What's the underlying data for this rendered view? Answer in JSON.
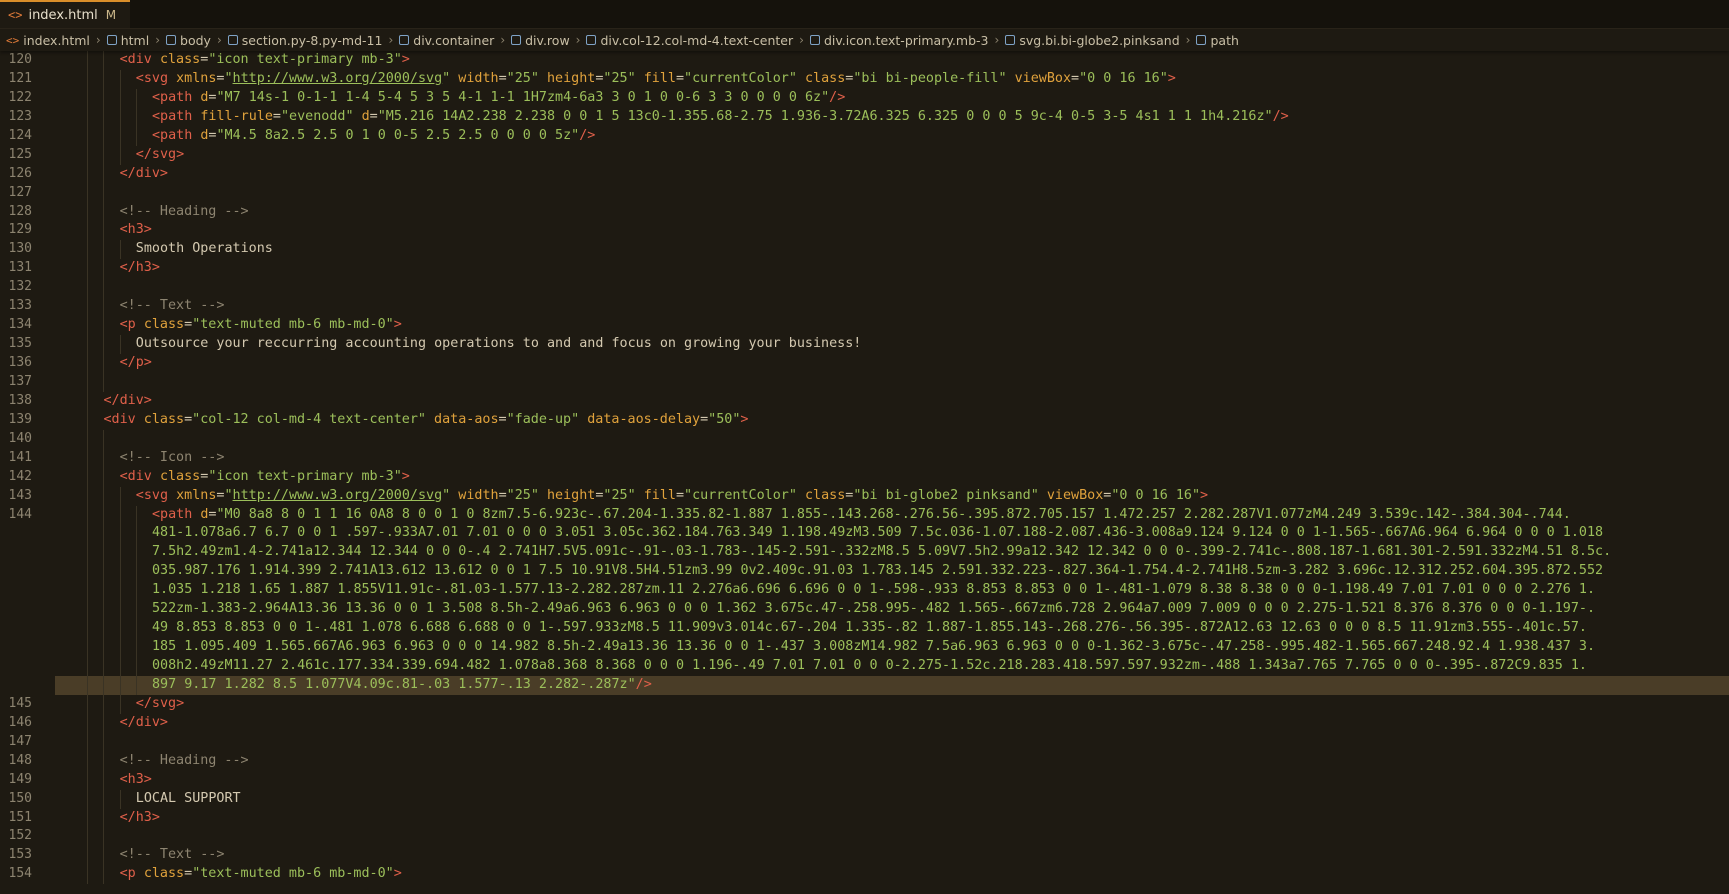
{
  "tab": {
    "filename": "index.html",
    "status": "M",
    "icon": "html-file-icon"
  },
  "breadcrumb": [
    {
      "label": "index.html",
      "icon": "html-file-icon"
    },
    {
      "label": "html",
      "icon": "element-icon"
    },
    {
      "label": "body",
      "icon": "element-icon"
    },
    {
      "label": "section.py-8.py-md-11",
      "icon": "element-icon"
    },
    {
      "label": "div.container",
      "icon": "element-icon"
    },
    {
      "label": "div.row",
      "icon": "element-icon"
    },
    {
      "label": "div.col-12.col-md-4.text-center",
      "icon": "element-icon"
    },
    {
      "label": "div.icon.text-primary.mb-3",
      "icon": "element-icon"
    },
    {
      "label": "svg.bi.bi-globe2.pinksand",
      "icon": "element-icon"
    },
    {
      "label": "path",
      "icon": "element-icon"
    }
  ],
  "lines": [
    {
      "n": "120",
      "indent": 8,
      "tokens": [
        [
          "tag",
          "<div "
        ],
        [
          "attr",
          "class"
        ],
        [
          "pun",
          "="
        ],
        [
          "str",
          "\"icon text-primary mb-3\""
        ],
        [
          "tag",
          ">"
        ]
      ]
    },
    {
      "n": "121",
      "indent": 10,
      "tokens": [
        [
          "tag",
          "<svg "
        ],
        [
          "attr",
          "xmlns"
        ],
        [
          "pun",
          "="
        ],
        [
          "str",
          "\""
        ],
        [
          "url",
          "http://www.w3.org/2000/svg"
        ],
        [
          "str",
          "\""
        ],
        [
          "pun",
          " "
        ],
        [
          "attr",
          "width"
        ],
        [
          "pun",
          "="
        ],
        [
          "str",
          "\"25\""
        ],
        [
          "pun",
          " "
        ],
        [
          "attr",
          "height"
        ],
        [
          "pun",
          "="
        ],
        [
          "str",
          "\"25\""
        ],
        [
          "pun",
          " "
        ],
        [
          "attr",
          "fill"
        ],
        [
          "pun",
          "="
        ],
        [
          "str",
          "\"currentColor\""
        ],
        [
          "pun",
          " "
        ],
        [
          "attr",
          "class"
        ],
        [
          "pun",
          "="
        ],
        [
          "str",
          "\"bi bi-people-fill\""
        ],
        [
          "pun",
          " "
        ],
        [
          "attr",
          "viewBox"
        ],
        [
          "pun",
          "="
        ],
        [
          "str",
          "\"0 0 16 16\""
        ],
        [
          "tag",
          ">"
        ]
      ]
    },
    {
      "n": "122",
      "indent": 12,
      "tokens": [
        [
          "tag",
          "<path "
        ],
        [
          "attr",
          "d"
        ],
        [
          "pun",
          "="
        ],
        [
          "str",
          "\"M7 14s-1 0-1-1 1-4 5-4 5 3 5 4-1 1-1 1H7zm4-6a3 3 0 1 0 0-6 3 3 0 0 0 0 6z\""
        ],
        [
          "tag",
          "/>"
        ]
      ]
    },
    {
      "n": "123",
      "indent": 12,
      "tokens": [
        [
          "tag",
          "<path "
        ],
        [
          "attr",
          "fill-rule"
        ],
        [
          "pun",
          "="
        ],
        [
          "str",
          "\"evenodd\""
        ],
        [
          "pun",
          " "
        ],
        [
          "attr",
          "d"
        ],
        [
          "pun",
          "="
        ],
        [
          "str",
          "\"M5.216 14A2.238 2.238 0 0 1 5 13c0-1.355.68-2.75 1.936-3.72A6.325 6.325 0 0 0 5 9c-4 0-5 3-5 4s1 1 1 1h4.216z\""
        ],
        [
          "tag",
          "/>"
        ]
      ]
    },
    {
      "n": "124",
      "indent": 12,
      "tokens": [
        [
          "tag",
          "<path "
        ],
        [
          "attr",
          "d"
        ],
        [
          "pun",
          "="
        ],
        [
          "str",
          "\"M4.5 8a2.5 2.5 0 1 0 0-5 2.5 2.5 0 0 0 0 5z\""
        ],
        [
          "tag",
          "/>"
        ]
      ]
    },
    {
      "n": "125",
      "indent": 10,
      "tokens": [
        [
          "tag",
          "</svg>"
        ]
      ]
    },
    {
      "n": "126",
      "indent": 8,
      "tokens": [
        [
          "tag",
          "</div>"
        ]
      ]
    },
    {
      "n": "127",
      "indent": 8,
      "tokens": []
    },
    {
      "n": "128",
      "indent": 8,
      "tokens": [
        [
          "com",
          "<!-- Heading -->"
        ]
      ]
    },
    {
      "n": "129",
      "indent": 8,
      "tokens": [
        [
          "tag",
          "<h3>"
        ]
      ]
    },
    {
      "n": "130",
      "indent": 10,
      "tokens": [
        [
          "txt",
          "Smooth Operations"
        ]
      ]
    },
    {
      "n": "131",
      "indent": 8,
      "tokens": [
        [
          "tag",
          "</h3>"
        ]
      ]
    },
    {
      "n": "132",
      "indent": 8,
      "tokens": []
    },
    {
      "n": "133",
      "indent": 8,
      "tokens": [
        [
          "com",
          "<!-- Text -->"
        ]
      ]
    },
    {
      "n": "134",
      "indent": 8,
      "tokens": [
        [
          "tag",
          "<p "
        ],
        [
          "attr",
          "class"
        ],
        [
          "pun",
          "="
        ],
        [
          "str",
          "\"text-muted mb-6 mb-md-0\""
        ],
        [
          "tag",
          ">"
        ]
      ]
    },
    {
      "n": "135",
      "indent": 10,
      "tokens": [
        [
          "txt",
          "Outsource your reccurring accounting operations to and and focus on growing your business!"
        ]
      ]
    },
    {
      "n": "136",
      "indent": 8,
      "tokens": [
        [
          "tag",
          "</p>"
        ]
      ]
    },
    {
      "n": "137",
      "indent": 8,
      "tokens": []
    },
    {
      "n": "138",
      "indent": 6,
      "tokens": [
        [
          "tag",
          "</div>"
        ]
      ]
    },
    {
      "n": "139",
      "indent": 6,
      "tokens": [
        [
          "tag",
          "<div "
        ],
        [
          "attr",
          "class"
        ],
        [
          "pun",
          "="
        ],
        [
          "str",
          "\"col-12 col-md-4 text-center\""
        ],
        [
          "pun",
          " "
        ],
        [
          "attr",
          "data-aos"
        ],
        [
          "pun",
          "="
        ],
        [
          "str",
          "\"fade-up\""
        ],
        [
          "pun",
          " "
        ],
        [
          "attr",
          "data-aos-delay"
        ],
        [
          "pun",
          "="
        ],
        [
          "str",
          "\"50\""
        ],
        [
          "tag",
          ">"
        ]
      ]
    },
    {
      "n": "140",
      "indent": 8,
      "tokens": []
    },
    {
      "n": "141",
      "indent": 8,
      "tokens": [
        [
          "com",
          "<!-- Icon -->"
        ]
      ]
    },
    {
      "n": "142",
      "indent": 8,
      "tokens": [
        [
          "tag",
          "<div "
        ],
        [
          "attr",
          "class"
        ],
        [
          "pun",
          "="
        ],
        [
          "str",
          "\"icon text-primary mb-3\""
        ],
        [
          "tag",
          ">"
        ]
      ]
    },
    {
      "n": "143",
      "indent": 10,
      "tokens": [
        [
          "tag",
          "<svg "
        ],
        [
          "attr",
          "xmlns"
        ],
        [
          "pun",
          "="
        ],
        [
          "str",
          "\""
        ],
        [
          "url",
          "http://www.w3.org/2000/svg"
        ],
        [
          "str",
          "\""
        ],
        [
          "pun",
          " "
        ],
        [
          "attr",
          "width"
        ],
        [
          "pun",
          "="
        ],
        [
          "str",
          "\"25\""
        ],
        [
          "pun",
          " "
        ],
        [
          "attr",
          "height"
        ],
        [
          "pun",
          "="
        ],
        [
          "str",
          "\"25\""
        ],
        [
          "pun",
          " "
        ],
        [
          "attr",
          "fill"
        ],
        [
          "pun",
          "="
        ],
        [
          "str",
          "\"currentColor\""
        ],
        [
          "pun",
          " "
        ],
        [
          "attr",
          "class"
        ],
        [
          "pun",
          "="
        ],
        [
          "str",
          "\"bi bi-globe2 pinksand\""
        ],
        [
          "pun",
          " "
        ],
        [
          "attr",
          "viewBox"
        ],
        [
          "pun",
          "="
        ],
        [
          "str",
          "\"0 0 16 16\""
        ],
        [
          "tag",
          ">"
        ]
      ]
    },
    {
      "n": "144",
      "indent": 12,
      "tokens": [
        [
          "tag",
          "<path "
        ],
        [
          "attr",
          "d"
        ],
        [
          "pun",
          "="
        ],
        [
          "str",
          "\"M0 8a8 8 0 1 1 16 0A8 8 0 0 1 0 8zm7.5-6.923c-.67.204-1.335.82-1.887 1.855-.143.268-.276.56-.395.872.705.157 1.472.257 2.282.287V1.077zM4.249 3.539c.142-.384.304-.744."
        ]
      ]
    },
    {
      "n": "",
      "indent": 12,
      "tokens": [
        [
          "str",
          "481-1.078a6.7 6.7 0 0 1 .597-.933A7.01 7.01 0 0 0 3.051 3.05c.362.184.763.349 1.198.49zM3.509 7.5c.036-1.07.188-2.087.436-3.008a9.124 9.124 0 0 1-1.565-.667A6.964 6.964 0 0 0 1.018"
        ]
      ]
    },
    {
      "n": "",
      "indent": 12,
      "tokens": [
        [
          "str",
          "7.5h2.49zm1.4-2.741a12.344 12.344 0 0 0-.4 2.741H7.5V5.091c-.91-.03-1.783-.145-2.591-.332zM8.5 5.09V7.5h2.99a12.342 12.342 0 0 0-.399-2.741c-.808.187-1.681.301-2.591.332zM4.51 8.5c."
        ]
      ]
    },
    {
      "n": "",
      "indent": 12,
      "tokens": [
        [
          "str",
          "035.987.176 1.914.399 2.741A13.612 13.612 0 0 1 7.5 10.91V8.5H4.51zm3.99 0v2.409c.91.03 1.783.145 2.591.332.223-.827.364-1.754.4-2.741H8.5zm-3.282 3.696c.12.312.252.604.395.872.552"
        ]
      ]
    },
    {
      "n": "",
      "indent": 12,
      "tokens": [
        [
          "str",
          "1.035 1.218 1.65 1.887 1.855V11.91c-.81.03-1.577.13-2.282.287zm.11 2.276a6.696 6.696 0 0 1-.598-.933 8.853 8.853 0 0 1-.481-1.079 8.38 8.38 0 0 0-1.198.49 7.01 7.01 0 0 0 2.276 1."
        ]
      ]
    },
    {
      "n": "",
      "indent": 12,
      "tokens": [
        [
          "str",
          "522zm-1.383-2.964A13.36 13.36 0 0 1 3.508 8.5h-2.49a6.963 6.963 0 0 0 1.362 3.675c.47-.258.995-.482 1.565-.667zm6.728 2.964a7.009 7.009 0 0 0 2.275-1.521 8.376 8.376 0 0 0-1.197-."
        ]
      ]
    },
    {
      "n": "",
      "indent": 12,
      "tokens": [
        [
          "str",
          "49 8.853 8.853 0 0 1-.481 1.078 6.688 6.688 0 0 1-.597.933zM8.5 11.909v3.014c.67-.204 1.335-.82 1.887-1.855.143-.268.276-.56.395-.872A12.63 12.63 0 0 0 8.5 11.91zm3.555-.401c.57."
        ]
      ]
    },
    {
      "n": "",
      "indent": 12,
      "tokens": [
        [
          "str",
          "185 1.095.409 1.565.667A6.963 6.963 0 0 0 14.982 8.5h-2.49a13.36 13.36 0 0 1-.437 3.008zM14.982 7.5a6.963 6.963 0 0 0-1.362-3.675c-.47.258-.995.482-1.565.667.248.92.4 1.938.437 3."
        ]
      ]
    },
    {
      "n": "",
      "indent": 12,
      "tokens": [
        [
          "str",
          "008h2.49zM11.27 2.461c.177.334.339.694.482 1.078a8.368 8.368 0 0 0 1.196-.49 7.01 7.01 0 0 0-2.275-1.52c.218.283.418.597.597.932zm-.488 1.343a7.765 7.765 0 0 0-.395-.872C9.835 1."
        ]
      ]
    },
    {
      "n": "",
      "indent": 12,
      "cur": true,
      "tokens": [
        [
          "str",
          "897 9.17 1.282 8.5 1.077V4.09c.81-.03 1.577-.13 2.282-.287z\""
        ],
        [
          "tag",
          "/>"
        ]
      ]
    },
    {
      "n": "145",
      "indent": 10,
      "tokens": [
        [
          "tag",
          "</svg>"
        ]
      ]
    },
    {
      "n": "146",
      "indent": 8,
      "tokens": [
        [
          "tag",
          "</div>"
        ]
      ]
    },
    {
      "n": "147",
      "indent": 8,
      "tokens": []
    },
    {
      "n": "148",
      "indent": 8,
      "tokens": [
        [
          "com",
          "<!-- Heading -->"
        ]
      ]
    },
    {
      "n": "149",
      "indent": 8,
      "tokens": [
        [
          "tag",
          "<h3>"
        ]
      ]
    },
    {
      "n": "150",
      "indent": 10,
      "tokens": [
        [
          "txt",
          "LOCAL SUPPORT"
        ]
      ]
    },
    {
      "n": "151",
      "indent": 8,
      "tokens": [
        [
          "tag",
          "</h3>"
        ]
      ]
    },
    {
      "n": "152",
      "indent": 8,
      "tokens": []
    },
    {
      "n": "153",
      "indent": 8,
      "tokens": [
        [
          "com",
          "<!-- Text -->"
        ]
      ]
    },
    {
      "n": "154",
      "indent": 8,
      "tokens": [
        [
          "tag",
          "<p "
        ],
        [
          "attr",
          "class"
        ],
        [
          "pun",
          "="
        ],
        [
          "str",
          "\"text-muted mb-6 mb-md-0\""
        ],
        [
          "tag",
          ">"
        ]
      ]
    }
  ]
}
